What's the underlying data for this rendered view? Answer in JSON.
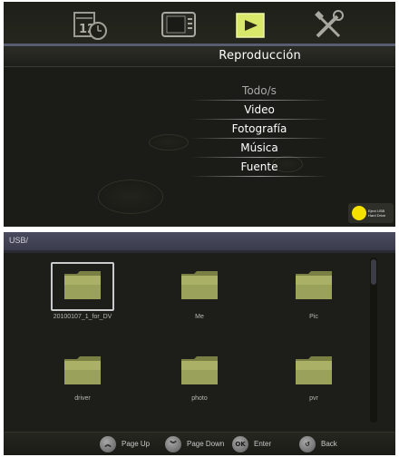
{
  "top": {
    "nav_icons": [
      {
        "name": "clock-calendar-icon",
        "active": false
      },
      {
        "name": "tv-icon",
        "active": false
      },
      {
        "name": "play-icon",
        "active": true
      },
      {
        "name": "tools-icon",
        "active": false
      }
    ],
    "title": "Reproducción",
    "menu": [
      {
        "label": "Todo/s",
        "dim": true
      },
      {
        "label": "Video",
        "dim": false
      },
      {
        "label": "Fotografía",
        "dim": false
      },
      {
        "label": "Música",
        "dim": false
      },
      {
        "label": "Fuente",
        "dim": false
      }
    ],
    "eject": {
      "line1": "Eject USB",
      "line2": "Hard Drive",
      "color": "#f4e100"
    }
  },
  "bottom": {
    "path": "USB/",
    "files": [
      {
        "name": "20100107_1_for_DV",
        "selected": true
      },
      {
        "name": "Me",
        "selected": false
      },
      {
        "name": "Pic",
        "selected": false
      },
      {
        "name": "driver",
        "selected": false
      },
      {
        "name": "photo",
        "selected": false
      },
      {
        "name": "pvr",
        "selected": false
      }
    ],
    "hints": [
      {
        "icon": "page-up-icon",
        "glyph": "︽",
        "label": "Page Up"
      },
      {
        "icon": "page-down-icon",
        "glyph": "︾",
        "label": "Page Down"
      },
      {
        "icon": "ok-icon",
        "glyph": "OK",
        "label": "Enter"
      },
      {
        "icon": "back-icon",
        "glyph": "↺",
        "label": "Back"
      }
    ]
  },
  "colors": {
    "accent_active": "#d9e86a",
    "folder": "#9aa15a",
    "nav_line": "#5a5d72"
  }
}
